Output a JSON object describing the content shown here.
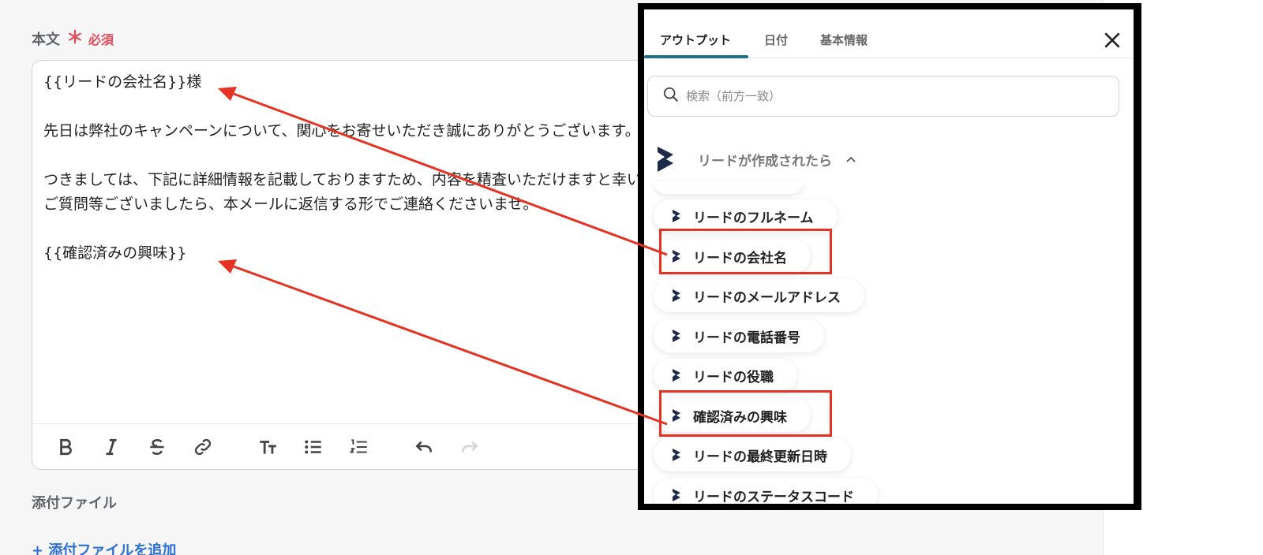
{
  "form": {
    "body_label": "本文",
    "required_star": "＊",
    "required_text": "必須",
    "body_lines": [
      "{{リードの会社名}}様",
      "",
      "先日は弊社のキャンペーンについて、関心をお寄せいただき誠にありがとうございます。",
      "",
      "つきましては、下記に詳細情報を記載しておりますため、内容を精査いただけますと幸いです。",
      "ご質問等ございましたら、本メールに返信する形でご連絡くださいませ。",
      "",
      "{{確認済みの興味}}"
    ],
    "toolbar": [
      "bold-icon",
      "italic-icon",
      "strikethrough-icon",
      "link-icon",
      "text-size-icon",
      "bullet-list-icon",
      "numbered-list-icon",
      "undo-icon",
      "redo-icon"
    ],
    "attachment_label": "添付ファイル",
    "attachment_add": "+ 添付ファイルを追加"
  },
  "panel": {
    "tabs": [
      "アウトプット",
      "日付",
      "基本情報"
    ],
    "active_tab": "アウトプット",
    "search_placeholder": "検索（前方一致）",
    "group_title": "リードが作成されたら",
    "items": [
      "リードのフルネーム",
      "リードの会社名",
      "リードのメールアドレス",
      "リードの電話番号",
      "リードの役職",
      "確認済みの興味",
      "リードの最終更新日時",
      "リードのステータスコード"
    ],
    "highlighted_items": [
      "リードの会社名",
      "確認済みの興味"
    ]
  },
  "colors": {
    "accent_teal": "#1f6f86",
    "required_red": "#e94a5a",
    "annotation_red": "#e53222",
    "link_blue": "#2a6fd6",
    "dynamics_logo": "#1e2a4a"
  }
}
